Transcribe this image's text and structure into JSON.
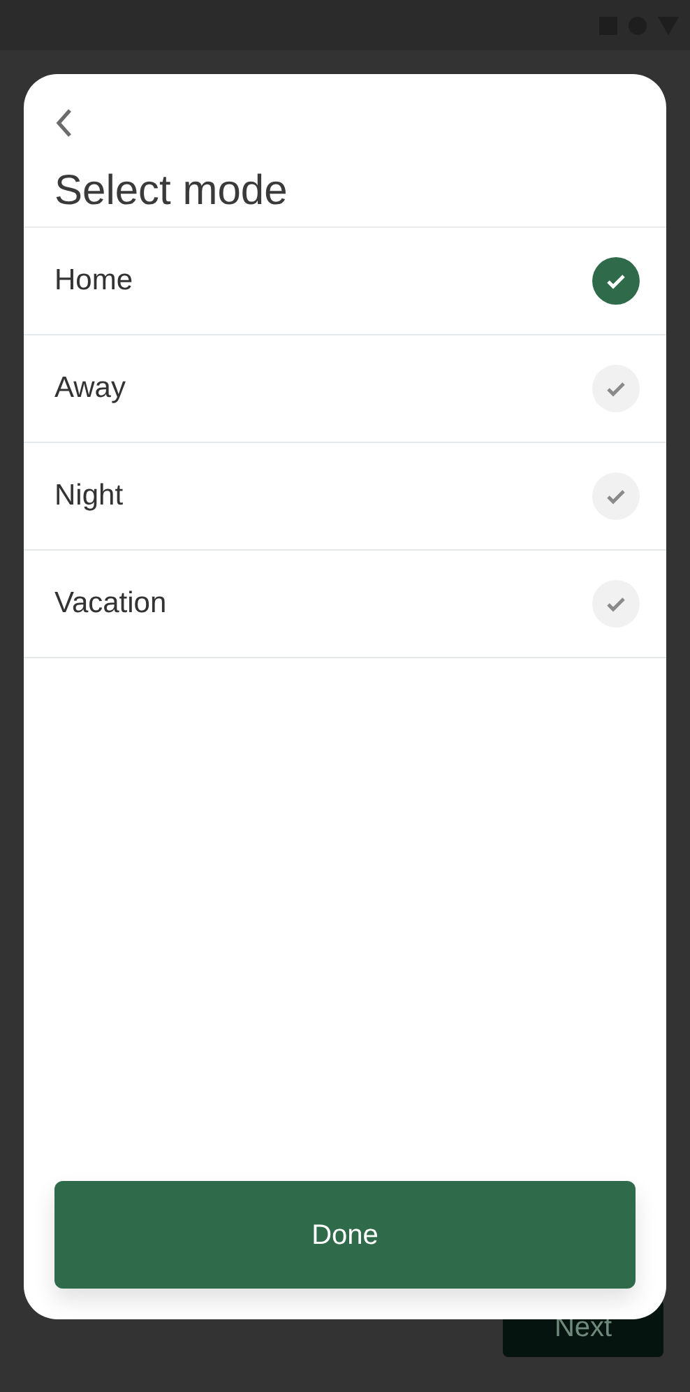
{
  "sheet": {
    "title": "Select mode",
    "modes": [
      {
        "label": "Home",
        "selected": true
      },
      {
        "label": "Away",
        "selected": false
      },
      {
        "label": "Night",
        "selected": false
      },
      {
        "label": "Vacation",
        "selected": false
      }
    ],
    "primary_button": "Done"
  },
  "background_button": "Next"
}
